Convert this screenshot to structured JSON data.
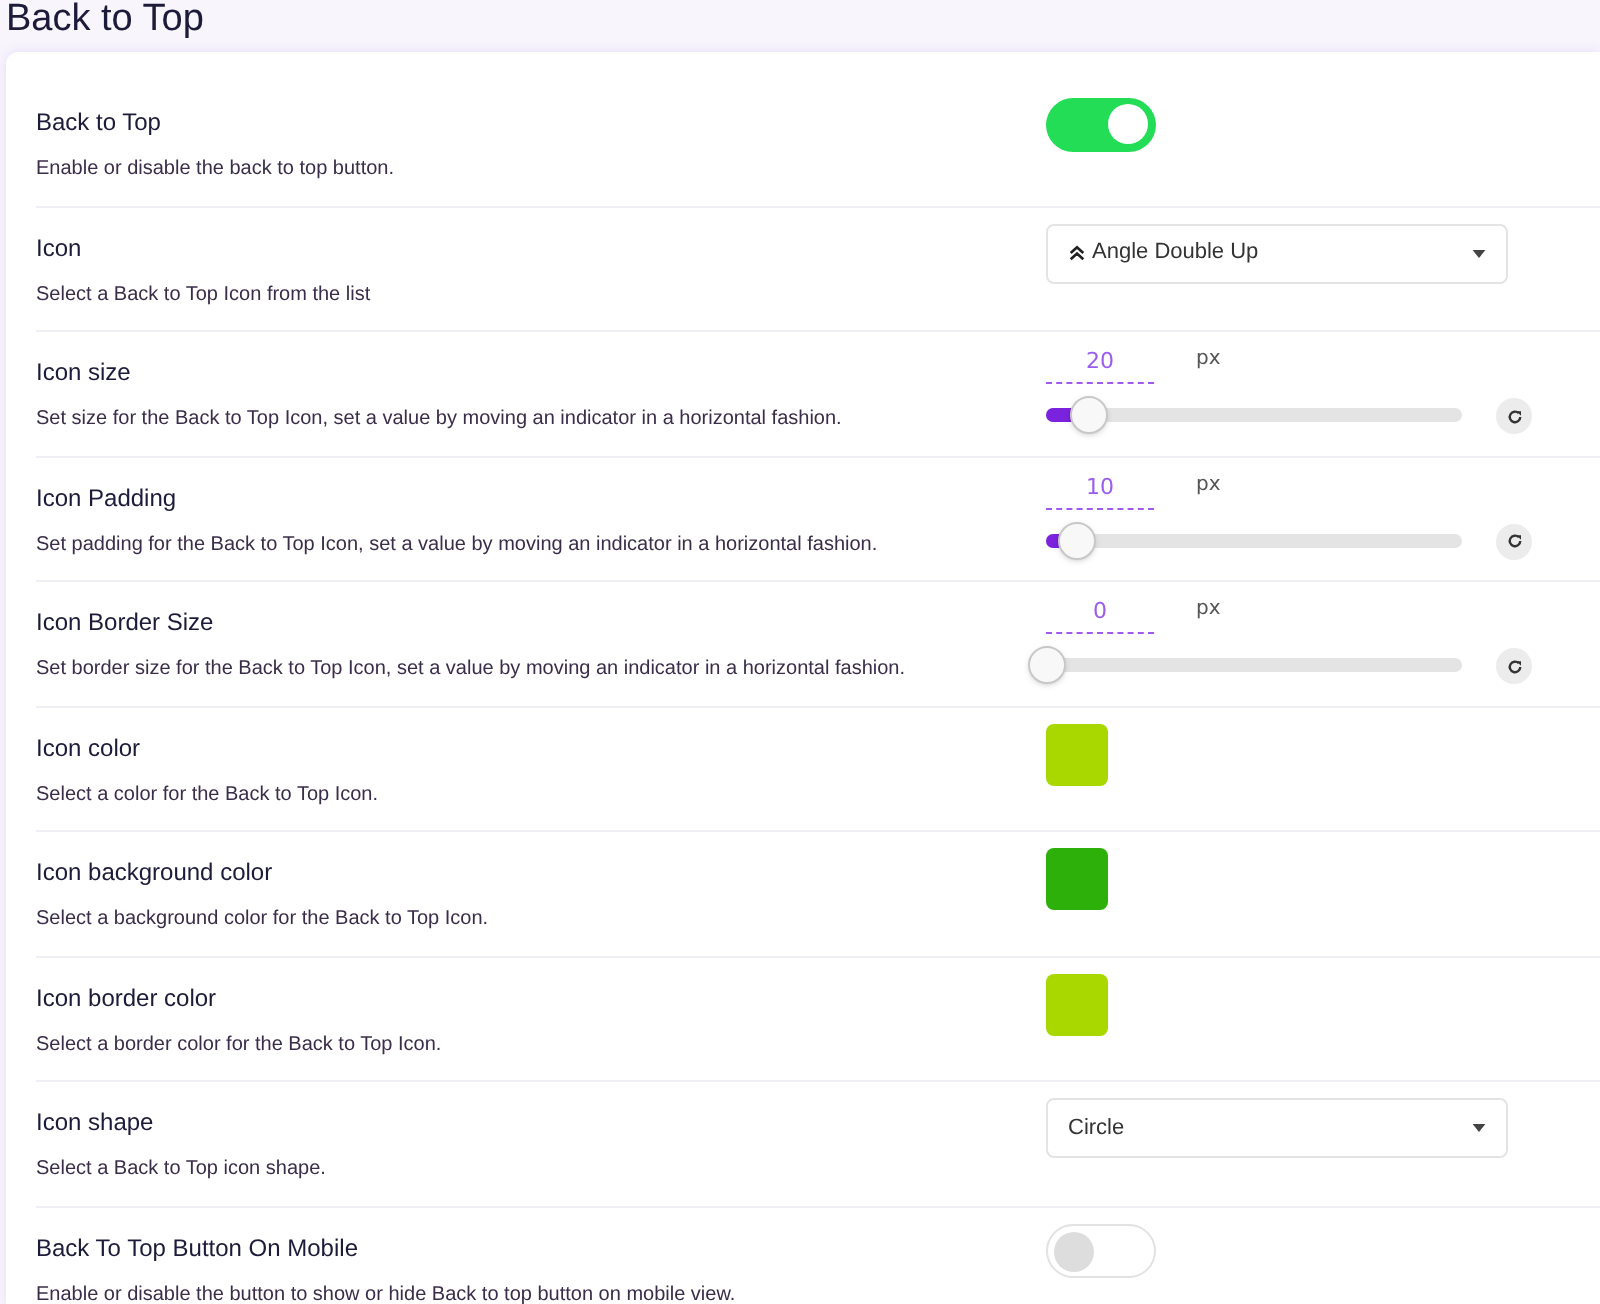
{
  "page_title": "Back to Top",
  "settings": [
    {
      "kind": "toggle",
      "label": "Back to Top",
      "description": "Enable or disable the back to top button.",
      "on": true
    },
    {
      "kind": "select",
      "label": "Icon",
      "description": "Select a Back to Top Icon from the list",
      "value": "Angle Double Up",
      "has_icon": true
    },
    {
      "kind": "slider",
      "label": "Icon size",
      "description": "Set size for the Back to Top Icon, set a value by moving an indicator in a horizontal fashion.",
      "value": "20",
      "unit": "px",
      "level": 0.1
    },
    {
      "kind": "slider",
      "label": "Icon Padding",
      "description": "Set padding for the Back to Top Icon, set a value by moving an indicator in a horizontal fashion.",
      "value": "10",
      "unit": "px",
      "level": 0.07
    },
    {
      "kind": "slider",
      "label": "Icon Border Size",
      "description": "Set border size for the Back to Top Icon, set a value by moving an indicator in a horizontal fashion.",
      "value": "0",
      "unit": "px",
      "level": 0
    },
    {
      "kind": "color",
      "label": "Icon color",
      "description": "Select a color for the Back to Top Icon.",
      "color": "#a8d800"
    },
    {
      "kind": "color",
      "label": "Icon background color",
      "description": "Select a background color for the Back to Top Icon.",
      "color": "#2db10a"
    },
    {
      "kind": "color",
      "label": "Icon border color",
      "description": "Select a border color for the Back to Top Icon.",
      "color": "#a8d800"
    },
    {
      "kind": "select",
      "label": "Icon shape",
      "description": "Select a Back to Top icon shape.",
      "value": "Circle",
      "has_icon": false
    },
    {
      "kind": "toggle",
      "label": "Back To Top Button On Mobile",
      "description": "Enable or disable the button to show or hide Back to top button on mobile view.",
      "on": false
    }
  ]
}
